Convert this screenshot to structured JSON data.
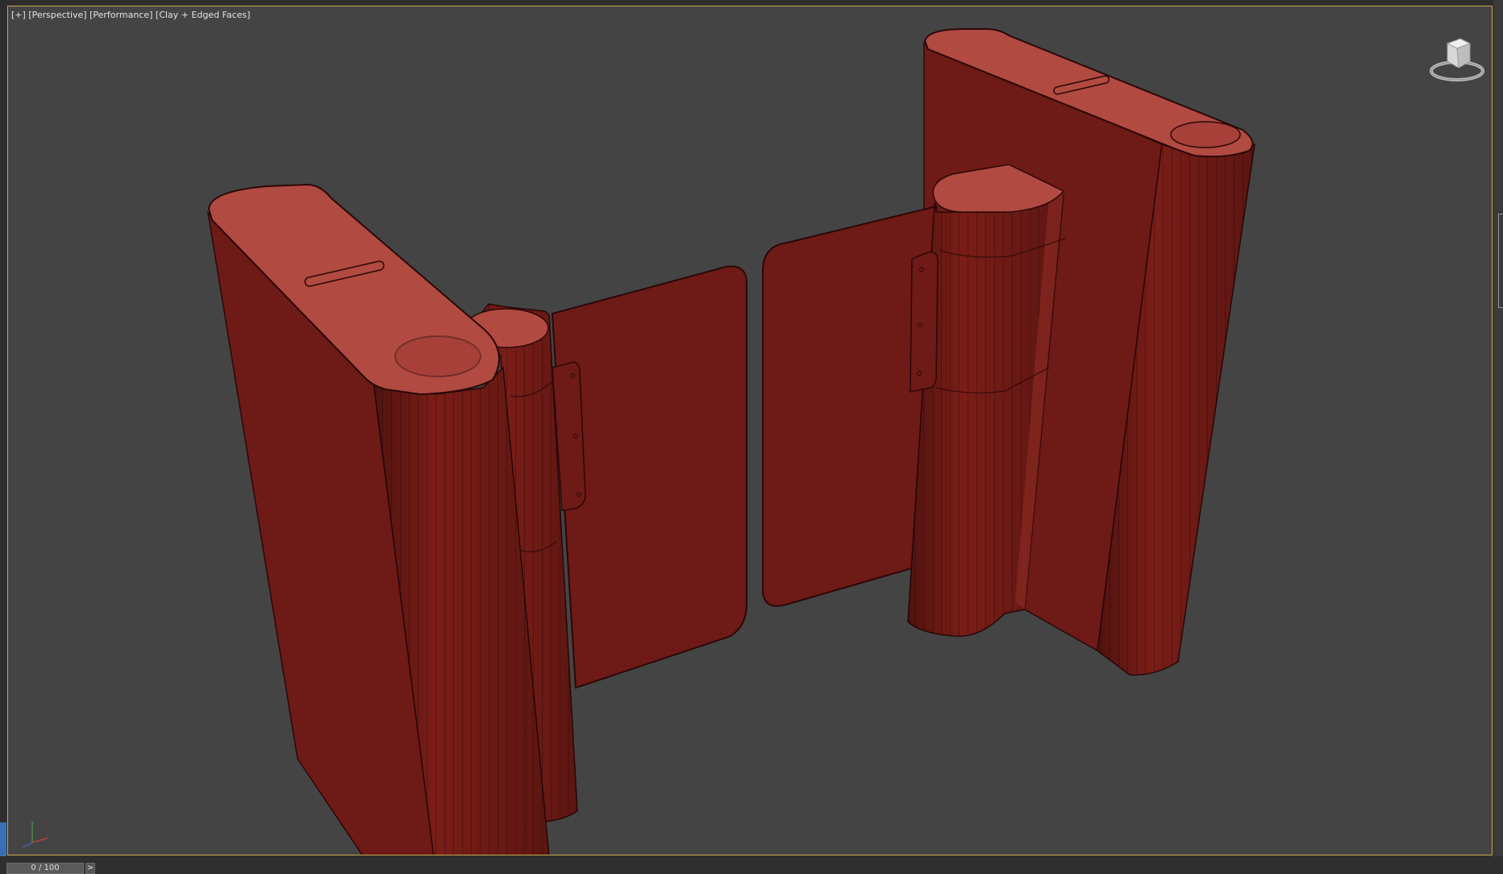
{
  "viewport": {
    "labels": [
      "[+]",
      "[Perspective]",
      "[Performance]",
      "[Clay + Edged Faces]"
    ],
    "colors": {
      "background": "#444444",
      "border": "#c8a84e",
      "clay_dark": "#6e1a16",
      "clay_mid": "#822019",
      "clay_top": "#b14a41",
      "edge": "#2a0808"
    },
    "icons": {
      "viewcube": "viewcube-icon",
      "axis_tripod": "axis-tripod-icon"
    }
  },
  "timeline": {
    "frame_label": "0 / 100",
    "next_label": ">"
  }
}
